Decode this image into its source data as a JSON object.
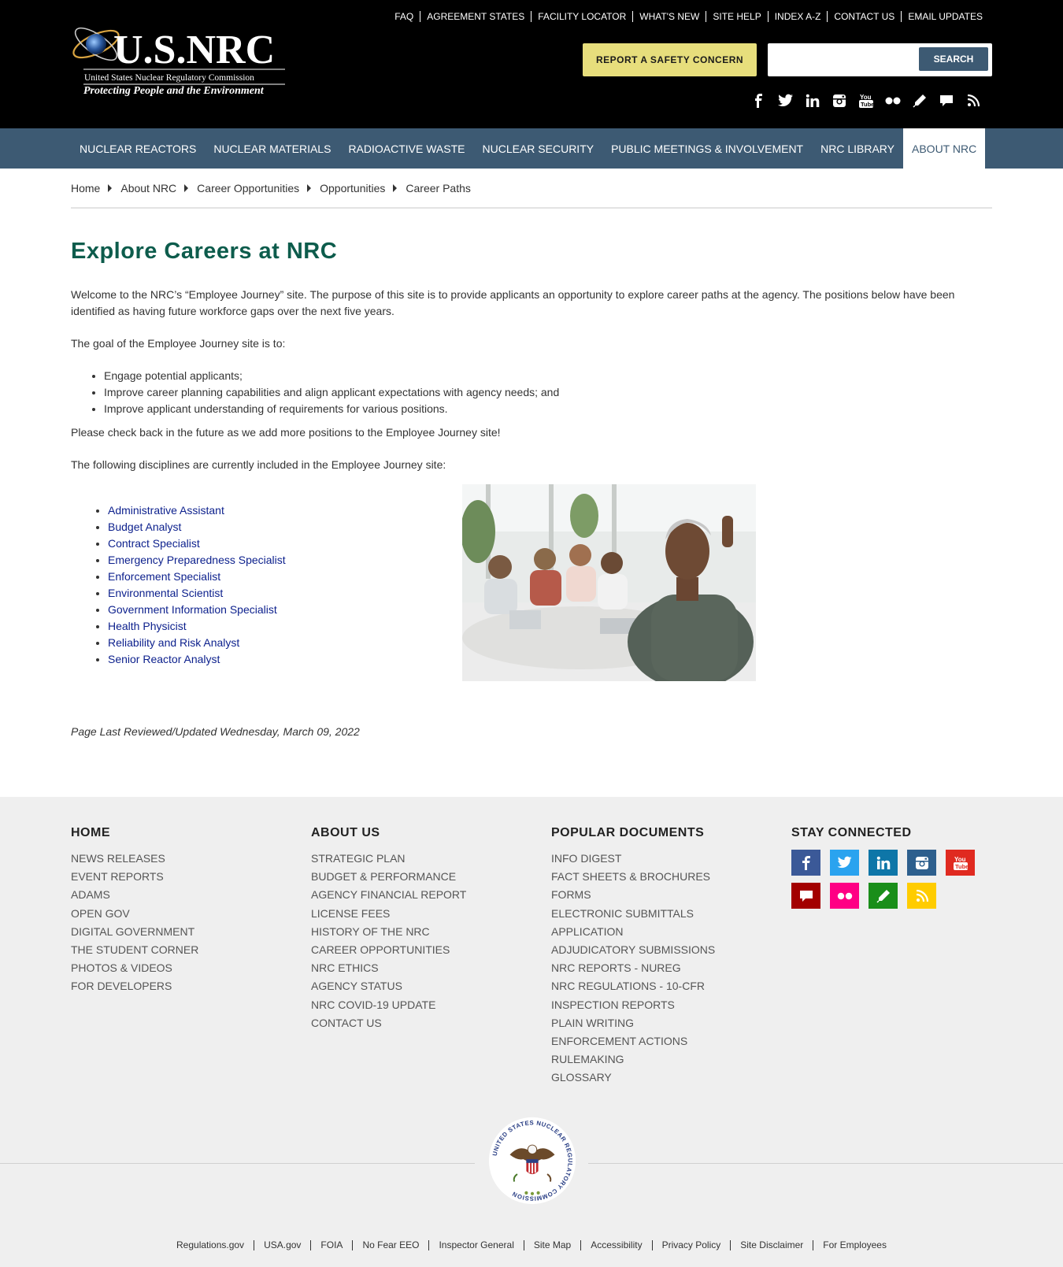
{
  "header": {
    "logo_text_big": "U.S.NRC",
    "logo_text_sub": "United States Nuclear Regulatory Commission",
    "logo_tagline": "Protecting People and the Environment",
    "top_links": [
      "FAQ",
      "AGREEMENT STATES",
      "FACILITY LOCATOR",
      "WHAT'S NEW",
      "SITE HELP",
      "INDEX A-Z",
      "CONTACT US",
      "EMAIL UPDATES"
    ],
    "report_button": "REPORT A SAFETY CONCERN",
    "search_button": "SEARCH",
    "search_value": "",
    "social_icons": [
      "facebook-icon",
      "twitter-icon",
      "linkedin-icon",
      "instagram-icon",
      "youtube-icon",
      "flickr-icon",
      "blog-icon",
      "comment-icon",
      "rss-icon"
    ]
  },
  "nav": {
    "items": [
      "NUCLEAR REACTORS",
      "NUCLEAR MATERIALS",
      "RADIOACTIVE WASTE",
      "NUCLEAR SECURITY",
      "PUBLIC MEETINGS & INVOLVEMENT",
      "NRC LIBRARY",
      "ABOUT NRC"
    ],
    "active": "ABOUT NRC"
  },
  "breadcrumb": [
    "Home",
    "About NRC",
    "Career Opportunities",
    "Opportunities",
    "Career Paths"
  ],
  "main": {
    "title": "Explore Careers at NRC",
    "intro": "Welcome to the NRC’s “Employee Journey” site. The purpose of this site is to provide applicants an opportunity to explore career paths at the agency. The positions below have been identified as having future workforce gaps over the next five years.",
    "goal_intro": "The goal of the Employee Journey site is to:",
    "goals": [
      "Engage potential applicants;",
      "Improve career planning capabilities and align applicant expectations with agency needs; and",
      "Improve applicant understanding of requirements for various positions."
    ],
    "check_back": "Please check back in the future as we add more positions to the Employee Journey site!",
    "disciplines_intro": "The following disciplines are currently included in the Employee Journey site:",
    "careers": [
      "Administrative Assistant",
      "Budget Analyst",
      "Contract Specialist",
      "Emergency Preparedness Specialist",
      "Enforcement Specialist",
      "Environmental Scientist",
      "Government Information Specialist",
      "Health Physicist",
      "Reliability and Risk Analyst",
      "Senior Reactor Analyst"
    ],
    "last_reviewed": "Page Last Reviewed/Updated Wednesday, March 09, 2022"
  },
  "footer": {
    "home": {
      "title": "HOME",
      "links": [
        "NEWS RELEASES",
        "EVENT REPORTS",
        "ADAMS",
        "OPEN GOV",
        "DIGITAL GOVERNMENT",
        "THE STUDENT CORNER",
        "PHOTOS & VIDEOS",
        "FOR DEVELOPERS"
      ]
    },
    "about": {
      "title": "ABOUT US",
      "links": [
        "STRATEGIC PLAN",
        "BUDGET & PERFORMANCE",
        "AGENCY FINANCIAL REPORT",
        "LICENSE FEES",
        "HISTORY OF THE NRC",
        "CAREER OPPORTUNITIES",
        "NRC ETHICS",
        "AGENCY STATUS",
        "NRC COVID-19 UPDATE",
        "CONTACT US"
      ]
    },
    "popular": {
      "title": "POPULAR DOCUMENTS",
      "links": [
        "INFO DIGEST",
        "FACT SHEETS & BROCHURES",
        "FORMS",
        "ELECTRONIC SUBMITTALS",
        "APPLICATION",
        "ADJUDICATORY SUBMISSIONS",
        "NRC REPORTS - NUREG",
        "NRC REGULATIONS - 10-CFR",
        "INSPECTION REPORTS",
        "PLAIN WRITING",
        "ENFORCEMENT ACTIONS",
        "RULEMAKING",
        "GLOSSARY"
      ]
    },
    "stay_connected": {
      "title": "STAY CONNECTED",
      "icons": [
        {
          "name": "facebook-icon",
          "color": "#3b5998"
        },
        {
          "name": "twitter-icon",
          "color": "#2aa3ef"
        },
        {
          "name": "linkedin-icon",
          "color": "#0e76a8"
        },
        {
          "name": "instagram-icon",
          "color": "#2d5f8d"
        },
        {
          "name": "youtube-icon",
          "color": "#e02a20"
        },
        {
          "name": "comment-icon",
          "color": "#a30000"
        },
        {
          "name": "flickr-icon",
          "color": "#ff0084"
        },
        {
          "name": "blog-icon",
          "color": "#1a8e1a"
        },
        {
          "name": "rss-icon",
          "color": "#ffcc00"
        }
      ]
    },
    "seal_text": "UNITED STATES NUCLEAR REGULATORY COMMISSION",
    "bottom_links": [
      "Regulations.gov",
      "USA.gov",
      "FOIA",
      "No Fear EEO",
      "Inspector General",
      "Site Map",
      "Accessibility",
      "Privacy Policy",
      "Site Disclaimer",
      "For Employees"
    ]
  }
}
